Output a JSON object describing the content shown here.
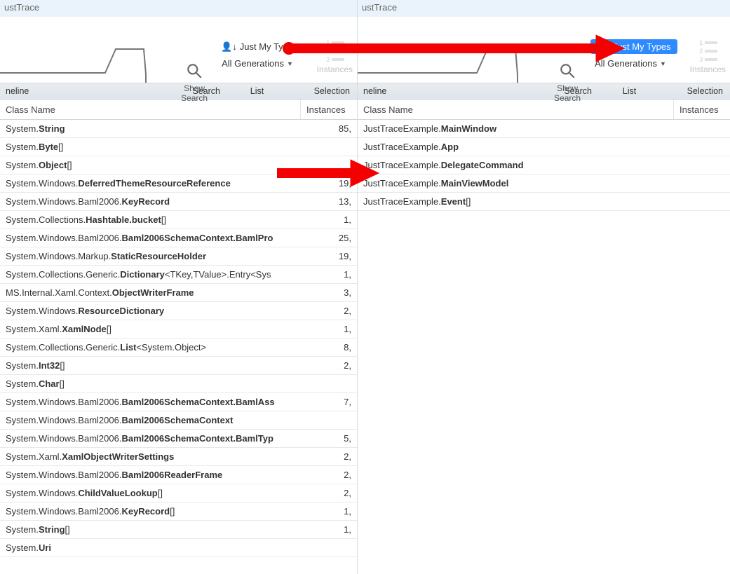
{
  "app_title": "ustTrace",
  "toolbar": {
    "show_search_label": "Show\nSearch",
    "just_my_types_label": "Just My Types",
    "all_generations_label": "All Generations",
    "instances_label": "Instances"
  },
  "section_bar": {
    "timeline": "neline",
    "search": "Search",
    "list": "List",
    "selection": "Selection"
  },
  "columns": {
    "class_name": "Class Name",
    "instances": "Instances"
  },
  "left_rows": [
    {
      "prefix": "System.",
      "bold": "String",
      "suffix": "",
      "instances": "85,"
    },
    {
      "prefix": "System.",
      "bold": "Byte",
      "suffix": "[]",
      "instances": ""
    },
    {
      "prefix": "System.",
      "bold": "Object",
      "suffix": "[]",
      "instances": ""
    },
    {
      "prefix": "System.Windows.",
      "bold": "DeferredThemeResourceReference",
      "suffix": "",
      "instances": "19,"
    },
    {
      "prefix": "System.Windows.Baml2006.",
      "bold": "KeyRecord",
      "suffix": "",
      "instances": "13,"
    },
    {
      "prefix": "System.Collections.",
      "bold": "Hashtable.bucket",
      "suffix": "[]",
      "instances": "1,"
    },
    {
      "prefix": "System.Windows.Baml2006.",
      "bold": "Baml2006SchemaContext.BamlPro",
      "suffix": "",
      "instances": "25,"
    },
    {
      "prefix": "System.Windows.Markup.",
      "bold": "StaticResourceHolder",
      "suffix": "",
      "instances": "19,"
    },
    {
      "prefix": "System.Collections.Generic.",
      "bold": "Dictionary",
      "suffix": "<TKey,TValue>.Entry<Sys",
      "instances": "1,"
    },
    {
      "prefix": "MS.Internal.Xaml.Context.",
      "bold": "ObjectWriterFrame",
      "suffix": "",
      "instances": "3,"
    },
    {
      "prefix": "System.Windows.",
      "bold": "ResourceDictionary",
      "suffix": "",
      "instances": "2,"
    },
    {
      "prefix": "System.Xaml.",
      "bold": "XamlNode",
      "suffix": "[]",
      "instances": "1,"
    },
    {
      "prefix": "System.Collections.Generic.",
      "bold": "List",
      "suffix": "<System.Object>",
      "instances": "8,"
    },
    {
      "prefix": "System.",
      "bold": "Int32",
      "suffix": "[]",
      "instances": "2,"
    },
    {
      "prefix": "System.",
      "bold": "Char",
      "suffix": "[]",
      "instances": ""
    },
    {
      "prefix": "System.Windows.Baml2006.",
      "bold": "Baml2006SchemaContext.BamlAss",
      "suffix": "",
      "instances": "7,"
    },
    {
      "prefix": "System.Windows.Baml2006.",
      "bold": "Baml2006SchemaContext",
      "suffix": "",
      "instances": ""
    },
    {
      "prefix": "System.Windows.Baml2006.",
      "bold": "Baml2006SchemaContext.BamlTyp",
      "suffix": "",
      "instances": "5,"
    },
    {
      "prefix": "System.Xaml.",
      "bold": "XamlObjectWriterSettings",
      "suffix": "",
      "instances": "2,"
    },
    {
      "prefix": "System.Windows.Baml2006.",
      "bold": "Baml2006ReaderFrame",
      "suffix": "",
      "instances": "2,"
    },
    {
      "prefix": "System.Windows.",
      "bold": "ChildValueLookup",
      "suffix": "[]",
      "instances": "2,"
    },
    {
      "prefix": "System.Windows.Baml2006.",
      "bold": "KeyRecord",
      "suffix": "[]",
      "instances": "1,"
    },
    {
      "prefix": "System.",
      "bold": "String",
      "suffix": "[]",
      "instances": "1,"
    },
    {
      "prefix": "System.",
      "bold": "Uri",
      "suffix": "",
      "instances": ""
    }
  ],
  "right_rows": [
    {
      "prefix": "JustTraceExample.",
      "bold": "MainWindow",
      "suffix": "",
      "instances": ""
    },
    {
      "prefix": "JustTraceExample.",
      "bold": "App",
      "suffix": "",
      "instances": ""
    },
    {
      "prefix": "JustTraceExample.",
      "bold": "DelegateCommand",
      "suffix": "",
      "instances": ""
    },
    {
      "prefix": "JustTraceExample.",
      "bold": "MainViewModel",
      "suffix": "",
      "instances": ""
    },
    {
      "prefix": "JustTraceExample.",
      "bold": "Event",
      "suffix": "[]",
      "instances": ""
    }
  ]
}
